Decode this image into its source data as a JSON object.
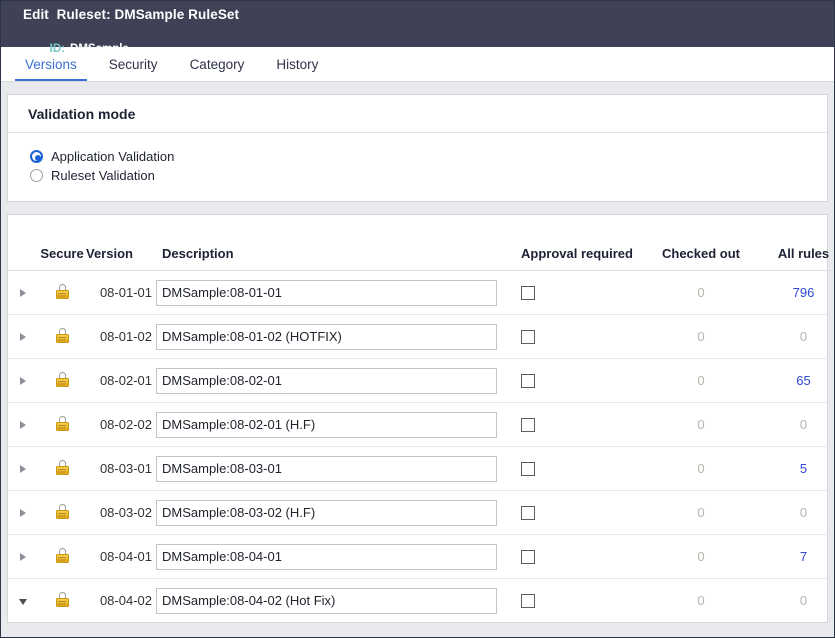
{
  "header": {
    "title": "Edit  Ruleset: DMSample RuleSet",
    "id_label": "ID:",
    "id_value": "DMSample",
    "bg_color": "#3f4256",
    "id_label_color": "#76c5c5"
  },
  "tabs": [
    {
      "label": "Versions",
      "active": true
    },
    {
      "label": "Security",
      "active": false
    },
    {
      "label": "Category",
      "active": false
    },
    {
      "label": "History",
      "active": false
    }
  ],
  "accent_color": "#3b6fd4",
  "validation": {
    "panel_title": "Validation mode",
    "options": [
      {
        "label": "Application Validation",
        "selected": true
      },
      {
        "label": "Ruleset Validation",
        "selected": false
      }
    ]
  },
  "table": {
    "columns": {
      "secure": "Secure",
      "version": "Version",
      "description": "Description",
      "approval_required": "Approval required",
      "checked_out": "Checked out",
      "all_rules": "All rules"
    },
    "rows": [
      {
        "expanded": false,
        "secure_icon": "lock-icon",
        "version": "08-01-01",
        "description": "DMSample:08-01-01",
        "approval_required": false,
        "checked_out": "0",
        "all_rules": "796",
        "all_rules_link": true
      },
      {
        "expanded": false,
        "secure_icon": "lock-icon",
        "version": "08-01-02",
        "description": "DMSample:08-01-02 (HOTFIX)",
        "approval_required": false,
        "checked_out": "0",
        "all_rules": "0",
        "all_rules_link": false
      },
      {
        "expanded": false,
        "secure_icon": "lock-icon",
        "version": "08-02-01",
        "description": "DMSample:08-02-01",
        "approval_required": false,
        "checked_out": "0",
        "all_rules": "65",
        "all_rules_link": true
      },
      {
        "expanded": false,
        "secure_icon": "lock-icon",
        "version": "08-02-02",
        "description": "DMSample:08-02-01 (H.F)",
        "approval_required": false,
        "checked_out": "0",
        "all_rules": "0",
        "all_rules_link": false
      },
      {
        "expanded": false,
        "secure_icon": "lock-icon",
        "version": "08-03-01",
        "description": "DMSample:08-03-01",
        "approval_required": false,
        "checked_out": "0",
        "all_rules": "5",
        "all_rules_link": true
      },
      {
        "expanded": false,
        "secure_icon": "lock-icon",
        "version": "08-03-02",
        "description": "DMSample:08-03-02 (H.F)",
        "approval_required": false,
        "checked_out": "0",
        "all_rules": "0",
        "all_rules_link": false
      },
      {
        "expanded": false,
        "secure_icon": "lock-icon",
        "version": "08-04-01",
        "description": "DMSample:08-04-01",
        "approval_required": false,
        "checked_out": "0",
        "all_rules": "7",
        "all_rules_link": true
      },
      {
        "expanded": true,
        "secure_icon": "lock-icon",
        "version": "08-04-02",
        "description": "DMSample:08-04-02 (Hot Fix)",
        "approval_required": false,
        "checked_out": "0",
        "all_rules": "0",
        "all_rules_link": false
      }
    ]
  }
}
